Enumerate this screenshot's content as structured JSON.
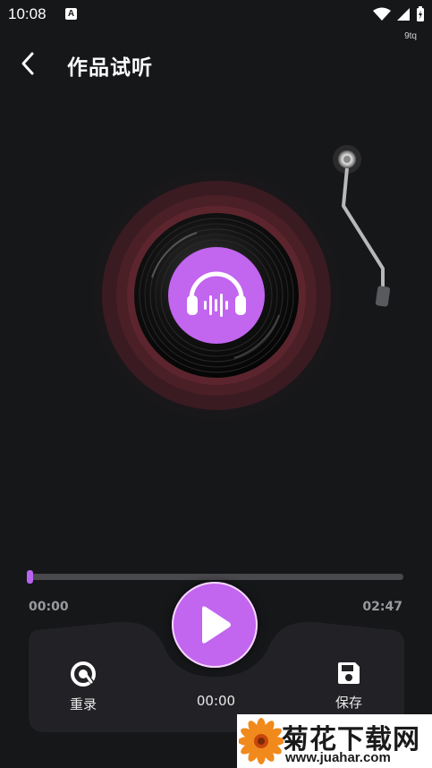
{
  "status_bar": {
    "time": "10:08",
    "badge": "A",
    "carrier": "9tq",
    "icons": [
      "wifi-icon",
      "signal-icon",
      "battery-charging-icon"
    ]
  },
  "header": {
    "back_icon": "chevron-left-icon",
    "title": "作品试听"
  },
  "player": {
    "center_icon": "headphones-icon",
    "current_time": "00:00",
    "total_time": "02:47",
    "progress": 0.0
  },
  "controls": {
    "rerecord": {
      "icon": "rerecord-icon",
      "label": "重录"
    },
    "play": {
      "icon": "play-icon"
    },
    "elapsed": "00:00",
    "save": {
      "icon": "save-icon",
      "label": "保存"
    }
  },
  "watermark": {
    "title": "菊花下载网",
    "url": "www.juahar.com"
  },
  "colors": {
    "background": "#161719",
    "accent": "#c265ef",
    "ring": "#6e2c34",
    "dock": "#222226"
  }
}
